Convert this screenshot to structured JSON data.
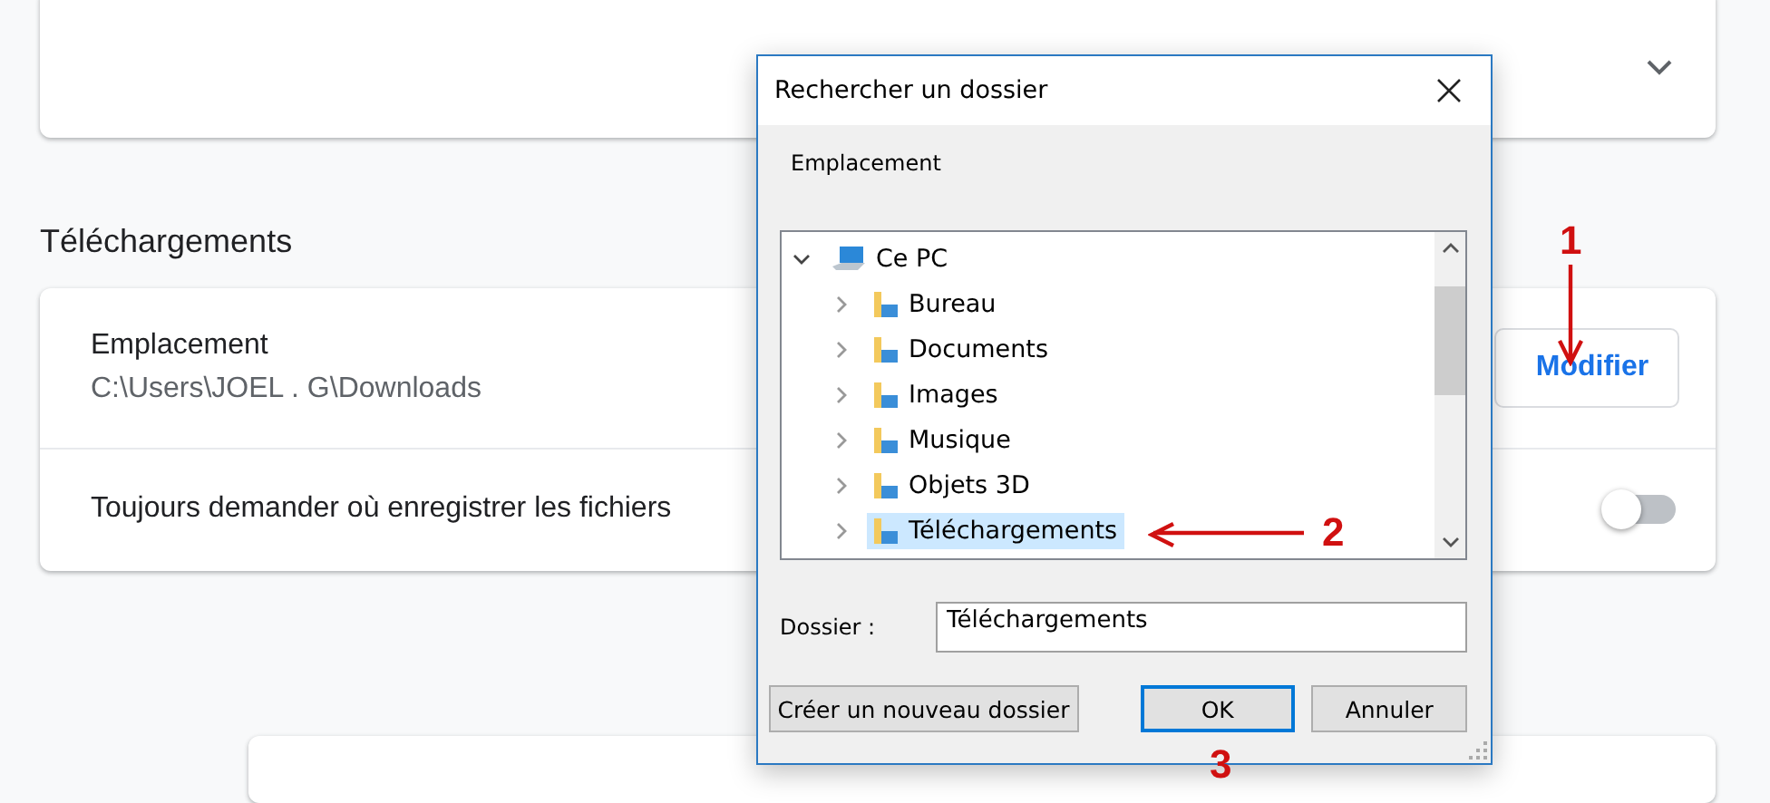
{
  "settings": {
    "section_title": "Téléchargements",
    "location": {
      "label": "Emplacement",
      "path": "C:\\Users\\JOEL . G\\Downloads",
      "button": "Modifier"
    },
    "ask_toggle": {
      "label": "Toujours demander où enregistrer les fichiers",
      "on": false
    }
  },
  "dialog": {
    "title": "Rechercher un dossier",
    "description": "Emplacement",
    "tree": [
      {
        "label": "Ce PC",
        "expanded": true,
        "selected": false,
        "children": [
          {
            "label": "Bureau",
            "expanded": false,
            "selected": false
          },
          {
            "label": "Documents",
            "expanded": false,
            "selected": false
          },
          {
            "label": "Images",
            "expanded": false,
            "selected": false
          },
          {
            "label": "Musique",
            "expanded": false,
            "selected": false
          },
          {
            "label": "Objets 3D",
            "expanded": false,
            "selected": false
          },
          {
            "label": "Téléchargements",
            "expanded": false,
            "selected": true
          }
        ]
      }
    ],
    "folder_label": "Dossier :",
    "folder_value": "Téléchargements",
    "buttons": [
      {
        "label": "Créer un nouveau dossier",
        "kind": "secondary"
      },
      {
        "label": "OK",
        "kind": "default"
      },
      {
        "label": "Annuler",
        "kind": "secondary"
      }
    ]
  },
  "annotations": [
    {
      "label": "1"
    },
    {
      "label": "2"
    },
    {
      "label": "3"
    }
  ]
}
